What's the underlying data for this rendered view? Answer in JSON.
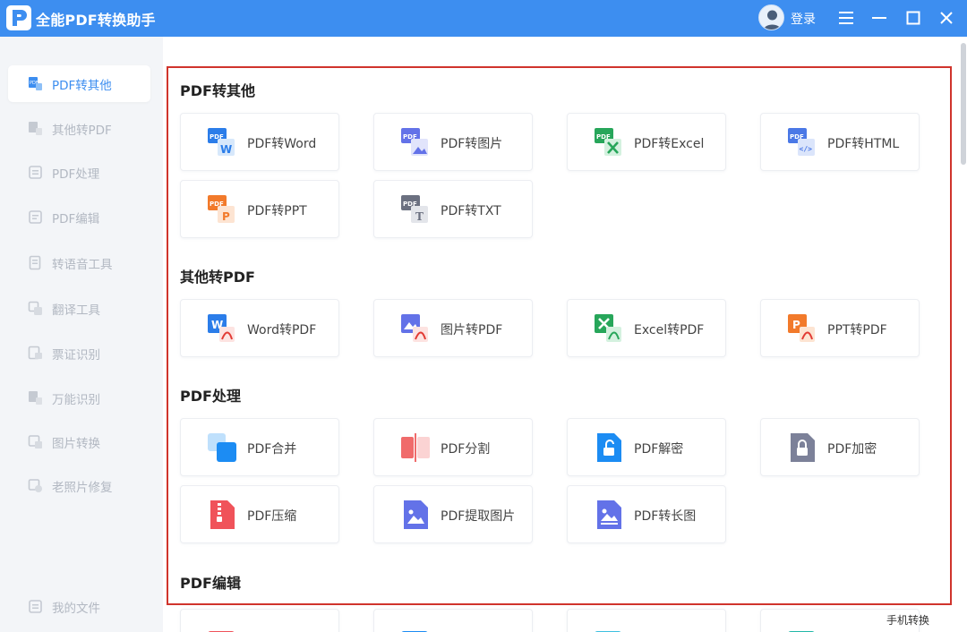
{
  "app": {
    "title": "全能PDF转换助手",
    "login_label": "登录",
    "accent": "#3d8ef0",
    "highlight": "#d0342c"
  },
  "sidebar": {
    "items": [
      {
        "label": "PDF转其他",
        "icon": "pdf-convert-icon",
        "active": true
      },
      {
        "label": "其他转PDF",
        "icon": "to-pdf-icon"
      },
      {
        "label": "PDF处理",
        "icon": "pdf-process-icon"
      },
      {
        "label": "PDF编辑",
        "icon": "pdf-edit-icon"
      },
      {
        "label": "转语音工具",
        "icon": "voice-tool-icon"
      },
      {
        "label": "翻译工具",
        "icon": "translate-icon"
      },
      {
        "label": "票证识别",
        "icon": "ticket-ocr-icon"
      },
      {
        "label": "万能识别",
        "icon": "universal-ocr-icon"
      },
      {
        "label": "图片转换",
        "icon": "image-convert-icon"
      },
      {
        "label": "老照片修复",
        "icon": "photo-repair-icon"
      }
    ],
    "my_files": "我的文件"
  },
  "sections": [
    {
      "title": "PDF转其他",
      "items": [
        {
          "label": "PDF转Word",
          "icon": "pdf-to-word-icon"
        },
        {
          "label": "PDF转图片",
          "icon": "pdf-to-image-icon"
        },
        {
          "label": "PDF转Excel",
          "icon": "pdf-to-excel-icon"
        },
        {
          "label": "PDF转HTML",
          "icon": "pdf-to-html-icon"
        },
        {
          "label": "PDF转PPT",
          "icon": "pdf-to-ppt-icon"
        },
        {
          "label": "PDF转TXT",
          "icon": "pdf-to-txt-icon"
        }
      ]
    },
    {
      "title": "其他转PDF",
      "items": [
        {
          "label": "Word转PDF",
          "icon": "word-to-pdf-icon"
        },
        {
          "label": "图片转PDF",
          "icon": "image-to-pdf-icon"
        },
        {
          "label": "Excel转PDF",
          "icon": "excel-to-pdf-icon"
        },
        {
          "label": "PPT转PDF",
          "icon": "ppt-to-pdf-icon"
        }
      ]
    },
    {
      "title": "PDF处理",
      "items": [
        {
          "label": "PDF合并",
          "icon": "pdf-merge-icon"
        },
        {
          "label": "PDF分割",
          "icon": "pdf-split-icon"
        },
        {
          "label": "PDF解密",
          "icon": "pdf-decrypt-icon"
        },
        {
          "label": "PDF加密",
          "icon": "pdf-encrypt-icon"
        },
        {
          "label": "PDF压缩",
          "icon": "pdf-compress-icon"
        },
        {
          "label": "PDF提取图片",
          "icon": "pdf-extract-image-icon"
        },
        {
          "label": "PDF转长图",
          "icon": "pdf-to-long-image-icon"
        }
      ]
    },
    {
      "title": "PDF编辑"
    }
  ],
  "bottom_link": "手机转换"
}
